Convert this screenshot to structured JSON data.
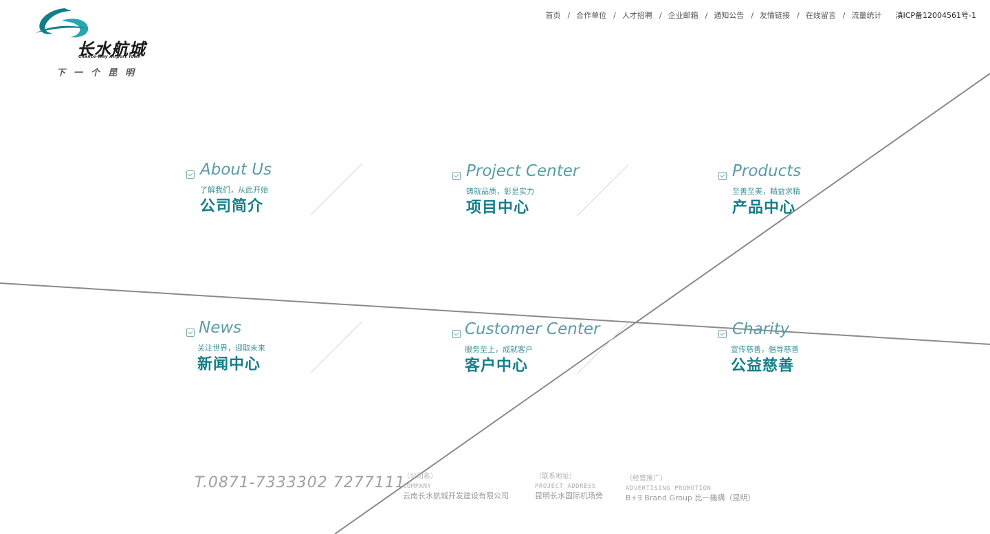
{
  "logo": {
    "name_cn": "长水航城",
    "name_en": "Chance-Way Airport Town",
    "slogan": "下一个昆明"
  },
  "nav": {
    "items": [
      {
        "label": "首页"
      },
      {
        "label": "合作单位"
      },
      {
        "label": "人才招聘"
      },
      {
        "label": "企业邮箱"
      },
      {
        "label": "通知公告"
      },
      {
        "label": "友情链接"
      },
      {
        "label": "在线留言"
      },
      {
        "label": "流量统计"
      }
    ],
    "separator": "/",
    "icp": "滇ICP备12004561号-1"
  },
  "tiles": [
    {
      "en": "About Us",
      "sub": "了解我们，从此开始",
      "cn": "公司简介",
      "icon": "check-box-icon"
    },
    {
      "en": "Project Center",
      "sub": "铸就品质，彰显实力",
      "cn": "项目中心",
      "icon": "check-box-icon"
    },
    {
      "en": "Products",
      "sub": "至善至美，精益求精",
      "cn": "产品中心",
      "icon": "check-box-icon"
    },
    {
      "en": "News",
      "sub": "关注世界，迎取未来",
      "cn": "新闻中心",
      "icon": "check-box-icon"
    },
    {
      "en": "Customer Center",
      "sub": "服务至上，成就客户",
      "cn": "客户中心",
      "icon": "check-box-icon"
    },
    {
      "en": "Charity",
      "sub": "宣传慈善，倡导慈善",
      "cn": "公益慈善",
      "icon": "check-box-icon"
    }
  ],
  "footer": {
    "phone": "T.0871-7333302 7277111",
    "company": {
      "label_cn": "（公司名）",
      "label_en": "COMPANY",
      "value": "云南长水航城开发建设有限公司"
    },
    "address": {
      "label_cn": "（联系地址）",
      "label_en": "PROJECT ADDRESS",
      "value": "昆明长水国际机场旁"
    },
    "promotion": {
      "label_cn": "（经营推广）",
      "label_en": "ADVERTISING PROMOTION",
      "value": "B+∃ Brand Group 比一機構（昆明）"
    }
  },
  "colors": {
    "accent": "#137e8a",
    "accent_light": "#5a9ca6",
    "line": "#8a8a8a"
  }
}
